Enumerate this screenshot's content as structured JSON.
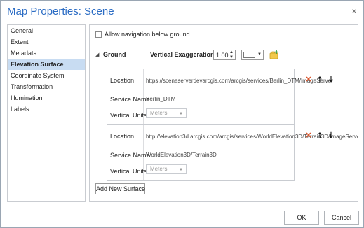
{
  "dialog": {
    "title": "Map Properties: Scene",
    "close_glyph": "×"
  },
  "sidebar": {
    "items": [
      {
        "label": "General"
      },
      {
        "label": "Extent"
      },
      {
        "label": "Metadata"
      },
      {
        "label": "Elevation Surface",
        "selected": true
      },
      {
        "label": "Coordinate System"
      },
      {
        "label": "Transformation"
      },
      {
        "label": "Illumination"
      },
      {
        "label": "Labels"
      }
    ]
  },
  "main": {
    "allow_navigation_label": "Allow navigation below ground",
    "allow_navigation_checked": false,
    "ground": {
      "label": "Ground",
      "vertical_exaggeration_label": "Vertical Exaggeration",
      "vertical_exaggeration_value": "1.00",
      "color_value": "#ffffff"
    },
    "surfaces": [
      {
        "location_label": "Location",
        "location_value": "https://sceneserverdevarcgis.com/arcgis/services/Berlin_DTM/ImageServer",
        "service_name_label": "Service Name",
        "service_name_value": "Berlin_DTM",
        "vertical_units_label": "Vertical Units",
        "vertical_units_value": "Meters"
      },
      {
        "location_label": "Location",
        "location_value": "http://elevation3d.arcgis.com/arcgis/services/WorldElevation3D/Terrain3D/ImageServer",
        "service_name_label": "Service Name",
        "service_name_value": "WorldElevation3D/Terrain3D",
        "vertical_units_label": "Vertical Units",
        "vertical_units_value": "Meters"
      }
    ],
    "add_new_surface_label": "Add New Surface"
  },
  "footer": {
    "ok_label": "OK",
    "cancel_label": "Cancel"
  },
  "colors": {
    "accent": "#2b6cc4",
    "selected_bg": "#c8dcf2",
    "delete_icon": "#d9542b"
  }
}
